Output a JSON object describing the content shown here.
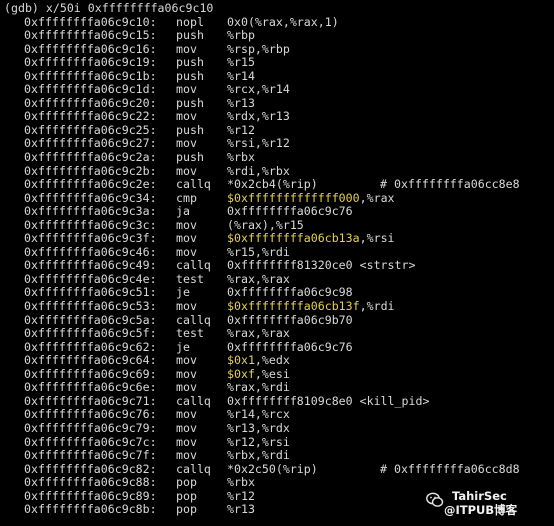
{
  "command": "(gdb) x/50i 0xffffffffa06c9c10",
  "instructions": [
    {
      "addr": "0xffffffffa06c9c10:",
      "mnem": "nopl",
      "op_hl": "",
      "op": "0x0(%rax,%rax,1)",
      "comment": ""
    },
    {
      "addr": "0xffffffffa06c9c15:",
      "mnem": "push",
      "op_hl": "",
      "op": "%rbp",
      "comment": ""
    },
    {
      "addr": "0xffffffffa06c9c16:",
      "mnem": "mov",
      "op_hl": "",
      "op": "%rsp,%rbp",
      "comment": ""
    },
    {
      "addr": "0xffffffffa06c9c19:",
      "mnem": "push",
      "op_hl": "",
      "op": "%r15",
      "comment": ""
    },
    {
      "addr": "0xffffffffa06c9c1b:",
      "mnem": "push",
      "op_hl": "",
      "op": "%r14",
      "comment": ""
    },
    {
      "addr": "0xffffffffa06c9c1d:",
      "mnem": "mov",
      "op_hl": "",
      "op": "%rcx,%r14",
      "comment": ""
    },
    {
      "addr": "0xffffffffa06c9c20:",
      "mnem": "push",
      "op_hl": "",
      "op": "%r13",
      "comment": ""
    },
    {
      "addr": "0xffffffffa06c9c22:",
      "mnem": "mov",
      "op_hl": "",
      "op": "%rdx,%r13",
      "comment": ""
    },
    {
      "addr": "0xffffffffa06c9c25:",
      "mnem": "push",
      "op_hl": "",
      "op": "%r12",
      "comment": ""
    },
    {
      "addr": "0xffffffffa06c9c27:",
      "mnem": "mov",
      "op_hl": "",
      "op": "%rsi,%r12",
      "comment": ""
    },
    {
      "addr": "0xffffffffa06c9c2a:",
      "mnem": "push",
      "op_hl": "",
      "op": "%rbx",
      "comment": ""
    },
    {
      "addr": "0xffffffffa06c9c2b:",
      "mnem": "mov",
      "op_hl": "",
      "op": "%rdi,%rbx",
      "comment": ""
    },
    {
      "addr": "0xffffffffa06c9c2e:",
      "mnem": "callq",
      "op_hl": "",
      "op": "*0x2cb4(%rip)",
      "comment": "# 0xffffffffa06cc8e8"
    },
    {
      "addr": "0xffffffffa06c9c34:",
      "mnem": "cmp",
      "op_hl": "$0xfffffffffffff000",
      "op": ",%rax",
      "comment": ""
    },
    {
      "addr": "0xffffffffa06c9c3a:",
      "mnem": "ja",
      "op_hl": "",
      "op": "0xffffffffa06c9c76",
      "comment": ""
    },
    {
      "addr": "0xffffffffa06c9c3c:",
      "mnem": "mov",
      "op_hl": "",
      "op": "(%rax),%r15",
      "comment": ""
    },
    {
      "addr": "0xffffffffa06c9c3f:",
      "mnem": "mov",
      "op_hl": "$0xffffffffa06cb13a",
      "op": ",%rsi",
      "comment": ""
    },
    {
      "addr": "0xffffffffa06c9c46:",
      "mnem": "mov",
      "op_hl": "",
      "op": "%r15,%rdi",
      "comment": ""
    },
    {
      "addr": "0xffffffffa06c9c49:",
      "mnem": "callq",
      "op_hl": "",
      "op": "0xffffffff81320ce0 <strstr>",
      "comment": ""
    },
    {
      "addr": "0xffffffffa06c9c4e:",
      "mnem": "test",
      "op_hl": "",
      "op": "%rax,%rax",
      "comment": ""
    },
    {
      "addr": "0xffffffffa06c9c51:",
      "mnem": "je",
      "op_hl": "",
      "op": "0xffffffffa06c9c98",
      "comment": ""
    },
    {
      "addr": "0xffffffffa06c9c53:",
      "mnem": "mov",
      "op_hl": "$0xffffffffa06cb13f",
      "op": ",%rdi",
      "comment": ""
    },
    {
      "addr": "0xffffffffa06c9c5a:",
      "mnem": "callq",
      "op_hl": "",
      "op": "0xffffffffa06c9b70",
      "comment": ""
    },
    {
      "addr": "0xffffffffa06c9c5f:",
      "mnem": "test",
      "op_hl": "",
      "op": "%rax,%rax",
      "comment": ""
    },
    {
      "addr": "0xffffffffa06c9c62:",
      "mnem": "je",
      "op_hl": "",
      "op": "0xffffffffa06c9c76",
      "comment": ""
    },
    {
      "addr": "0xffffffffa06c9c64:",
      "mnem": "mov",
      "op_hl": "$0x1",
      "op": ",%edx",
      "comment": ""
    },
    {
      "addr": "0xffffffffa06c9c69:",
      "mnem": "mov",
      "op_hl": "$0xf",
      "op": ",%esi",
      "comment": ""
    },
    {
      "addr": "0xffffffffa06c9c6e:",
      "mnem": "mov",
      "op_hl": "",
      "op": "%rax,%rdi",
      "comment": ""
    },
    {
      "addr": "0xffffffffa06c9c71:",
      "mnem": "callq",
      "op_hl": "",
      "op": "0xffffffff8109c8e0 <kill_pid>",
      "comment": ""
    },
    {
      "addr": "0xffffffffa06c9c76:",
      "mnem": "mov",
      "op_hl": "",
      "op": "%r14,%rcx",
      "comment": ""
    },
    {
      "addr": "0xffffffffa06c9c79:",
      "mnem": "mov",
      "op_hl": "",
      "op": "%r13,%rdx",
      "comment": ""
    },
    {
      "addr": "0xffffffffa06c9c7c:",
      "mnem": "mov",
      "op_hl": "",
      "op": "%r12,%rsi",
      "comment": ""
    },
    {
      "addr": "0xffffffffa06c9c7f:",
      "mnem": "mov",
      "op_hl": "",
      "op": "%rbx,%rdi",
      "comment": ""
    },
    {
      "addr": "0xffffffffa06c9c82:",
      "mnem": "callq",
      "op_hl": "",
      "op": "*0x2c50(%rip)",
      "comment": "# 0xffffffffa06cc8d8"
    },
    {
      "addr": "0xffffffffa06c9c88:",
      "mnem": "pop",
      "op_hl": "",
      "op": "%rbx",
      "comment": ""
    },
    {
      "addr": "0xffffffffa06c9c89:",
      "mnem": "pop",
      "op_hl": "",
      "op": "%r12",
      "comment": ""
    },
    {
      "addr": "0xffffffffa06c9c8b:",
      "mnem": "pop",
      "op_hl": "",
      "op": "%r13",
      "comment": ""
    }
  ],
  "watermark": {
    "name": "TahirSec",
    "site": "@ITPUB博客",
    "icon": "wechat-icon"
  },
  "colors": {
    "background": "#000000",
    "text": "#d9d9d9",
    "highlight": "#e5d24a"
  }
}
